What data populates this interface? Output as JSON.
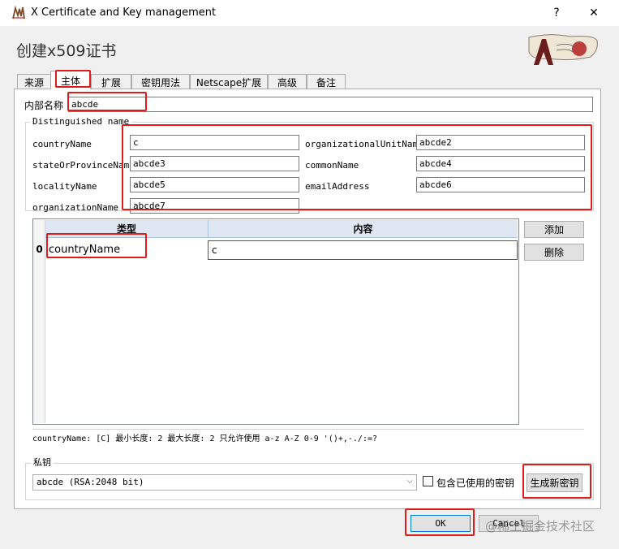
{
  "window": {
    "title": "X Certificate and Key management",
    "help_btn": "?",
    "close_btn": "✕"
  },
  "heading": "创建x509证书",
  "tabs": [
    {
      "label": "来源"
    },
    {
      "label": "主体"
    },
    {
      "label": "扩展"
    },
    {
      "label": "密钥用法"
    },
    {
      "label": "Netscape扩展"
    },
    {
      "label": "高级"
    },
    {
      "label": "备注"
    }
  ],
  "internal_name": {
    "label": "内部名称",
    "value": "abcde"
  },
  "distinguished_name": {
    "legend": "Distinguished name",
    "fields": [
      {
        "label": "countryName",
        "value": "c"
      },
      {
        "label": "organizationalUnitName",
        "value": "abcde2"
      },
      {
        "label": "stateOrProvinceName",
        "value": "abcde3"
      },
      {
        "label": "commonName",
        "value": "abcde4"
      },
      {
        "label": "localityName",
        "value": "abcde5"
      },
      {
        "label": "emailAddress",
        "value": "abcde6"
      },
      {
        "label": "organizationName",
        "value": "abcde7"
      }
    ]
  },
  "table": {
    "columns": [
      "类型",
      "内容"
    ],
    "rows": [
      {
        "index": "0",
        "type": "countryName",
        "content": "c"
      }
    ]
  },
  "add_btn": "添加",
  "delete_btn": "删除",
  "hint": "countryName: [C] 最小长度: 2 最大长度: 2 只允许使用 a-z A-Z 0-9 '()+,-./:=?",
  "private_key": {
    "legend": "私钥",
    "selected": "abcde (RSA:2048 bit)",
    "include_used_label": "包含已使用的密钥",
    "include_used_checked": false,
    "generate_btn": "生成新密钥"
  },
  "ok_btn": "OK",
  "cancel_btn": "Cancel",
  "watermark": "@稀土掘金技术社区",
  "colors": {
    "highlight": "#e01b1b",
    "table_header": "#dfe8f2"
  }
}
